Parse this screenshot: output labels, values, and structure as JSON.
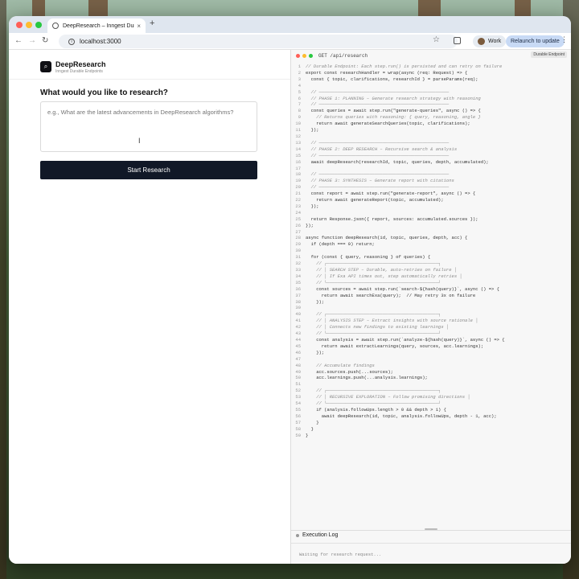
{
  "browser": {
    "tab_title": "DeepResearch – Inngest Durab",
    "url": "localhost:3000",
    "profile_label": "Work",
    "relaunch_label": "Relaunch to update"
  },
  "app": {
    "brand_name": "DeepResearch",
    "brand_sub": "Inngest Durable Endpoints",
    "prompt": "What would you like to research?",
    "input_placeholder": "e.g., What are the latest advancements in DeepResearch algorithms?",
    "start_button": "Start Research"
  },
  "code_panel": {
    "title": "GET /api/research",
    "badge": "Durable Endpoint",
    "lines": [
      "// Durable Endpoint: Each step.run() is persisted and can retry on failure",
      "export const researchHandler = wrap(async (req: Request) => {",
      "  const { topic, clarifications, researchId } = parseParams(req);",
      "",
      "  // ─────────────────────────────────────────────────",
      "  // PHASE 1: PLANNING – Generate research strategy with reasoning",
      "  // ─────────────────────────────────────────────────",
      "  const queries = await step.run(\"generate-queries\", async () => {",
      "    // Returns queries with reasoning: { query, reasoning, angle }",
      "    return await generateSearchQueries(topic, clarifications);",
      "  });",
      "",
      "  // ─────────────────────────────────────────────────",
      "  // PHASE 2: DEEP RESEARCH – Recursive search & analysis",
      "  // ─────────────────────────────────────────────────",
      "  await deepResearch(researchId, topic, queries, depth, accumulated);",
      "",
      "  // ─────────────────────────────────────────────────",
      "  // PHASE 3: SYNTHESIS – Generate report with citations",
      "  // ─────────────────────────────────────────────────",
      "  const report = await step.run(\"generate-report\", async () => {",
      "    return await generateReport(topic, accumulated);",
      "  });",
      "",
      "  return Response.json({ report, sources: accumulated.sources });",
      "});",
      "",
      "async function deepResearch(id, topic, queries, depth, acc) {",
      "  if (depth === 0) return;",
      "",
      "  for (const { query, reasoning } of queries) {",
      "    // ┌──────────────────────────────────────────┐",
      "    // │ SEARCH STEP – Durable, auto-retries on failure │",
      "    // │ If Exa API times out, step automatically retries │",
      "    // └──────────────────────────────────────────┘",
      "    const sources = await step.run(`search-${hash(query)}`, async () => {",
      "      return await searchExa(query);  // May retry 3x on failure",
      "    });",
      "",
      "    // ┌──────────────────────────────────────────┐",
      "    // │ ANALYSIS STEP – Extract insights with source rationale │",
      "    // │ Connects new findings to existing learnings │",
      "    // └──────────────────────────────────────────┘",
      "    const analysis = await step.run(`analyze-${hash(query)}`, async () => {",
      "      return await extractLearnings(query, sources, acc.learnings);",
      "    });",
      "",
      "    // Accumulate findings",
      "    acc.sources.push(...sources);",
      "    acc.learnings.push(...analysis.learnings);",
      "",
      "    // ┌──────────────────────────────────────────┐",
      "    // │ RECURSIVE EXPLORATION – Follow promising directions │",
      "    // └──────────────────────────────────────────┘",
      "    if (analysis.followUps.length > 0 && depth > 1) {",
      "      await deepResearch(id, topic, analysis.followUps, depth - 1, acc);",
      "    }",
      "  }",
      "}"
    ]
  },
  "execution_log": {
    "title": "Execution Log",
    "status": "Waiting for research request..."
  },
  "colors": {
    "button_bg": "#111827",
    "keyword": "#7a3fa8",
    "comment": "#8a8a8a"
  }
}
